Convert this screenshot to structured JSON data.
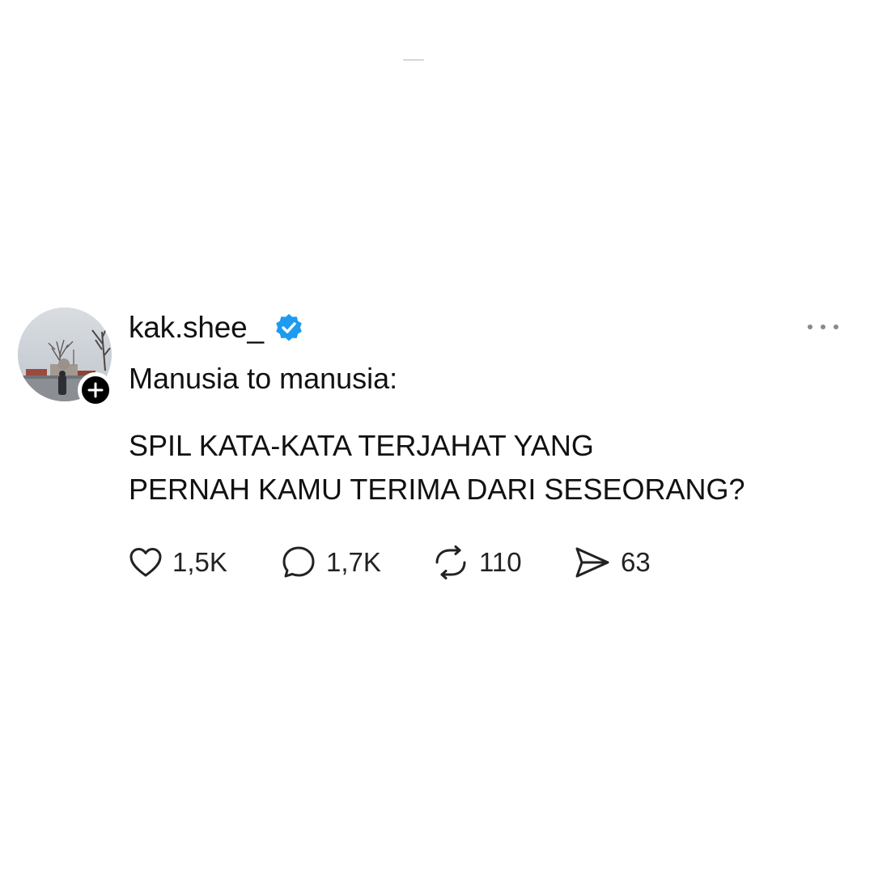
{
  "post": {
    "username": "kak.shee_",
    "verified": true,
    "intro": "Manusia to manusia:",
    "body_lines": [
      "SPIL KATA-KATA TERJAHAT YANG",
      "PERNAH KAMU TERIMA DARI SESEORANG?"
    ],
    "actions": {
      "likes": "1,5K",
      "replies": "1,7K",
      "reposts": "110",
      "shares": "63"
    }
  },
  "icons": {
    "like": "heart-icon",
    "reply": "speech-bubble-icon",
    "repost": "repost-icon",
    "share": "paper-plane-icon",
    "more": "ellipsis-icon",
    "follow": "plus-icon",
    "verified": "verified-badge-icon"
  },
  "colors": {
    "background": "#ffffff",
    "text": "#111111",
    "verified": "#1d9bf0",
    "icon": "#222222",
    "muted": "#8a8a8a"
  }
}
